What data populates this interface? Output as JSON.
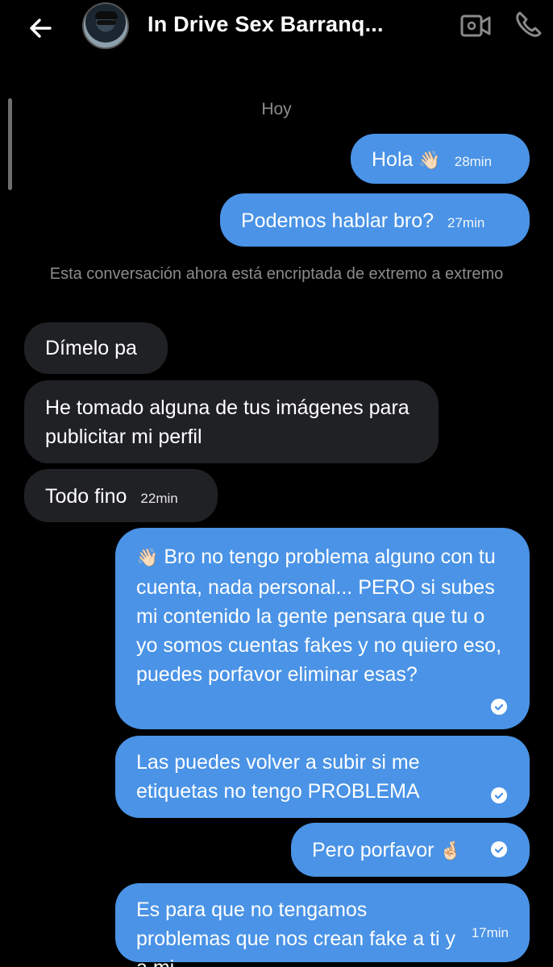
{
  "header": {
    "title": "In Drive Sex Barranq...",
    "back_icon": "arrow-left",
    "video_icon": "video-camera",
    "call_icon": "phone"
  },
  "day_separator": "Hoy",
  "encryption_notice": "Esta conversación ahora está encriptada de extremo a extremo",
  "messages": [
    {
      "direction": "out",
      "text": "Hola",
      "emoji": "👋🏻",
      "time": "28min"
    },
    {
      "direction": "out",
      "text": "Podemos hablar bro?",
      "time": "27min"
    },
    {
      "direction": "in",
      "text": "Dímelo pa"
    },
    {
      "direction": "in",
      "text": "He tomado alguna de tus imágenes para publicitar mi perfil"
    },
    {
      "direction": "in",
      "text": "Todo fino",
      "time": "22min"
    },
    {
      "direction": "out",
      "emoji": "👋🏻",
      "text": "Bro no tengo problema alguno con tu cuenta, nada personal... PERO si subes mi contenido la gente pensara que tu o yo somos cuentas fakes y no quiero eso, puedes porfavor eliminar esas?",
      "status": "seen"
    },
    {
      "direction": "out",
      "text": "Las puedes volver a subir si me etiquetas no tengo PROBLEMA",
      "status": "seen"
    },
    {
      "direction": "out",
      "text": "Pero porfavor",
      "emoji": "🤞🏻",
      "status": "seen"
    },
    {
      "direction": "out",
      "text": "Es para que no tengamos problemas que nos crean fake a ti y a mi",
      "time": "17min"
    }
  ],
  "colors": {
    "outgoing_bubble": "#4a93e6",
    "incoming_bubble": "#202124",
    "background": "#000000"
  }
}
